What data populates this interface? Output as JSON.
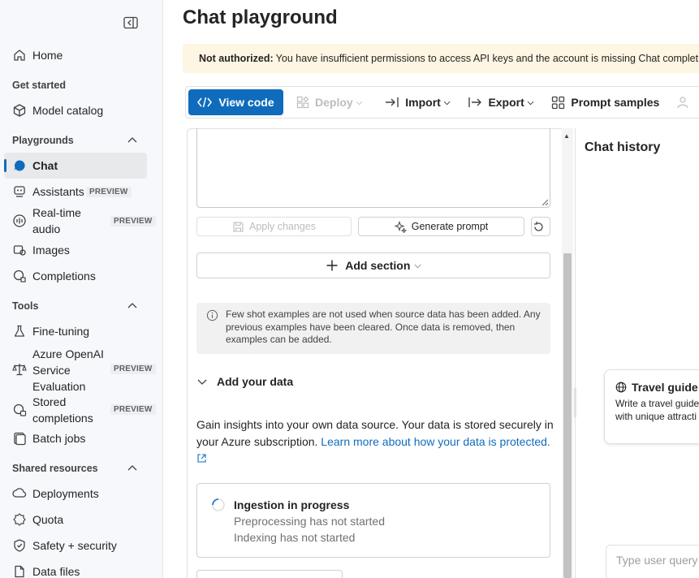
{
  "sidebar": {
    "items": [
      {
        "id": "home",
        "label": "Home",
        "icon": "home-icon"
      },
      {
        "id": "model-catalog",
        "label": "Model catalog",
        "icon": "cube-icon"
      },
      {
        "id": "chat",
        "label": "Chat",
        "icon": "chat-icon"
      },
      {
        "id": "assistants",
        "label": "Assistants",
        "icon": "assistants-icon",
        "badge": "PREVIEW"
      },
      {
        "id": "realtime-audio",
        "label": "Real-time\naudio",
        "icon": "audio-icon",
        "badge": "PREVIEW"
      },
      {
        "id": "images",
        "label": "Images",
        "icon": "images-icon"
      },
      {
        "id": "completions",
        "label": "Completions",
        "icon": "completions-icon"
      },
      {
        "id": "fine-tuning",
        "label": "Fine-tuning",
        "icon": "flask-icon"
      },
      {
        "id": "evaluation",
        "label": "Azure OpenAI\nService\nEvaluation",
        "icon": "scale-icon",
        "badge": "PREVIEW"
      },
      {
        "id": "stored-completions",
        "label": "Stored\ncompletions",
        "icon": "stored-icon",
        "badge": "PREVIEW"
      },
      {
        "id": "batch-jobs",
        "label": "Batch jobs",
        "icon": "batch-icon"
      },
      {
        "id": "deployments",
        "label": "Deployments",
        "icon": "deployments-icon"
      },
      {
        "id": "quota",
        "label": "Quota",
        "icon": "quota-icon"
      },
      {
        "id": "safety",
        "label": "Safety + security",
        "icon": "shield-icon"
      },
      {
        "id": "data-files",
        "label": "Data files",
        "icon": "file-icon"
      }
    ],
    "sections": {
      "get_started": "Get started",
      "playgrounds": "Playgrounds",
      "tools": "Tools",
      "shared": "Shared resources"
    }
  },
  "main": {
    "title": "Chat playground",
    "warning": {
      "bold": "Not authorized:",
      "text": "You have insufficient permissions to access API keys and the account is missing Chat completion"
    },
    "toolbar": {
      "view_code": "View code",
      "deploy": "Deploy",
      "import": "Import",
      "export": "Export",
      "prompt_samples": "Prompt samples"
    },
    "setup": {
      "apply_changes": "Apply changes",
      "generate_prompt": "Generate prompt",
      "add_section": "Add section",
      "info": "Few shot examples are not used when source data has been added. Any previous examples have been cleared. Once data is removed, then examples can be added.",
      "add_data_heading": "Add your data",
      "gain_text": "Gain insights into your own data source. Your data is stored securely in your Azure subscription.",
      "learn_more": "Learn more about how your data is protected.",
      "ingestion": {
        "title": "Ingestion in progress",
        "line1": "Preprocessing has not started",
        "line2": "Indexing has not started"
      }
    },
    "chat": {
      "history_title": "Chat history",
      "card_title": "Travel guide",
      "card_desc": "Write a travel guide\nwith unique attracti",
      "query_placeholder": "Type user query"
    }
  },
  "colors": {
    "accent": "#0f6cbd",
    "warning_bg": "#fdf6e3",
    "sidebar_bg": "#f6f8fb"
  }
}
